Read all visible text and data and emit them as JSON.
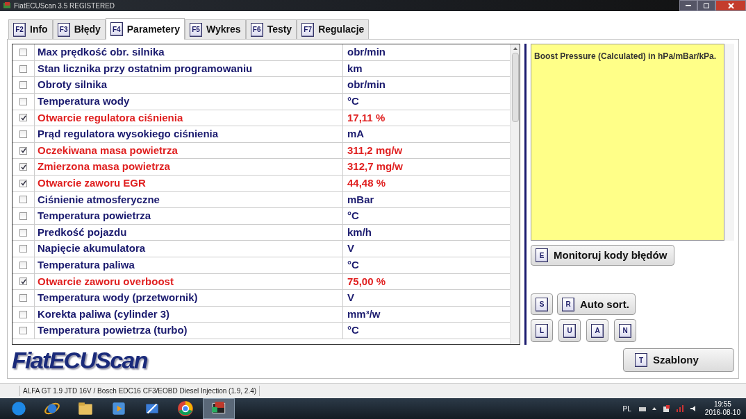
{
  "window": {
    "title": "FiatECUScan 3.5 REGISTERED"
  },
  "tabs": [
    {
      "key": "F2",
      "label": "Info",
      "selected": false
    },
    {
      "key": "F3",
      "label": "Błędy",
      "selected": false
    },
    {
      "key": "F4",
      "label": "Parametery",
      "selected": true
    },
    {
      "key": "F5",
      "label": "Wykres",
      "selected": false
    },
    {
      "key": "F6",
      "label": "Testy",
      "selected": false
    },
    {
      "key": "F7",
      "label": "Regulacje",
      "selected": false
    }
  ],
  "parameters": [
    {
      "name": "Max prędkość obr. silnika",
      "value": "obr/min",
      "checked": false
    },
    {
      "name": "Stan licznika przy ostatnim programowaniu",
      "value": "km",
      "checked": false
    },
    {
      "name": "Obroty silnika",
      "value": "obr/min",
      "checked": false
    },
    {
      "name": "Temperatura wody",
      "value": "°C",
      "checked": false
    },
    {
      "name": "Otwarcie regulatora ciśnienia",
      "value": "17,11 %",
      "checked": true
    },
    {
      "name": "Prąd regulatora wysokiego ciśnienia",
      "value": "mA",
      "checked": false
    },
    {
      "name": "Oczekiwana masa powietrza",
      "value": "311,2 mg/w",
      "checked": true
    },
    {
      "name": "Zmierzona masa powietrza",
      "value": "312,7 mg/w",
      "checked": true
    },
    {
      "name": "Otwarcie zaworu EGR",
      "value": "44,48 %",
      "checked": true
    },
    {
      "name": "Ciśnienie atmosferyczne",
      "value": "mBar",
      "checked": false
    },
    {
      "name": "Temperatura powietrza",
      "value": "°C",
      "checked": false
    },
    {
      "name": "Predkość pojazdu",
      "value": "km/h",
      "checked": false
    },
    {
      "name": "Napięcie akumulatora",
      "value": "V",
      "checked": false
    },
    {
      "name": "Temperatura paliwa",
      "value": "°C",
      "checked": false
    },
    {
      "name": "Otwarcie zaworu overboost",
      "value": "75,00 %",
      "checked": true
    },
    {
      "name": "Temperatura wody (przetwornik)",
      "value": "V",
      "checked": false
    },
    {
      "name": "Korekta paliwa (cylinder 3)",
      "value": "mm³/w",
      "checked": false
    },
    {
      "name": "Temperatura powietrza (turbo)",
      "value": "°C",
      "checked": false
    }
  ],
  "description": "Boost Pressure (Calculated) in hPa/mBar/kPa.",
  "monitor_button": {
    "key": "E",
    "label": "Monitoruj kody błędów"
  },
  "sort_buttons": [
    {
      "key": "S"
    },
    {
      "key": "R",
      "label": "Auto sort."
    }
  ],
  "filter_buttons": [
    {
      "key": "L"
    },
    {
      "key": "U"
    },
    {
      "key": "A"
    },
    {
      "key": "N"
    }
  ],
  "templates_button": {
    "key": "T",
    "label": "Szablony"
  },
  "logo": "FiatECUScan",
  "status_bar": "ALFA GT 1.9 JTD 16V / Bosch EDC16 CF3/EOBD Diesel Injection (1.9, 2.4)",
  "taskbar": {
    "language": "PL",
    "time": "19:55",
    "date": "2016-08-10"
  }
}
